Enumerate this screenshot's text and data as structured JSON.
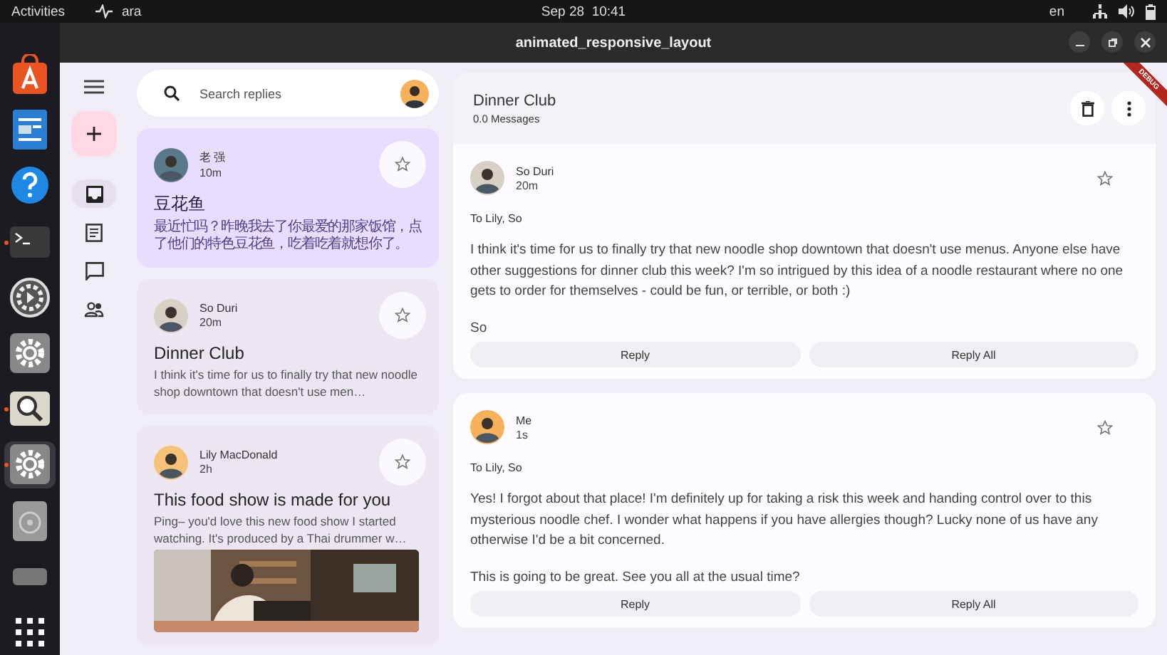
{
  "top_bar": {
    "activities": "Activities",
    "app": "ara",
    "date": "Sep 28",
    "time": "10:41",
    "language": "en"
  },
  "dock": [
    {
      "kind": "store",
      "running": false,
      "selected": false
    },
    {
      "kind": "writer",
      "running": false,
      "selected": false
    },
    {
      "kind": "help",
      "running": false,
      "selected": false
    },
    {
      "kind": "terminal",
      "running": true,
      "selected": false
    },
    {
      "kind": "media",
      "running": false,
      "selected": false
    },
    {
      "kind": "gear",
      "running": false,
      "selected": false
    },
    {
      "kind": "viewer",
      "running": true,
      "selected": false
    },
    {
      "kind": "gear",
      "running": true,
      "selected": true
    },
    {
      "kind": "disc",
      "running": false,
      "selected": false
    },
    {
      "kind": "drive",
      "running": false,
      "selected": false
    },
    {
      "kind": "apps",
      "running": false,
      "selected": false
    }
  ],
  "window": {
    "title": "animated_responsive_layout"
  },
  "debug_banner": "DEBUG",
  "nav": [
    {
      "kind": "inbox",
      "selected": true
    },
    {
      "kind": "articles",
      "selected": false
    },
    {
      "kind": "chat",
      "selected": false
    },
    {
      "kind": "groups",
      "selected": false
    }
  ],
  "search": {
    "placeholder": "Search replies"
  },
  "emails": [
    {
      "sender": "老 强",
      "time": "10m",
      "subject": "豆花鱼",
      "preview": "最近忙吗？昨晚我去了你最爱的那家饭馆，点了他们的特色豆花鱼，吃着吃着就想你了。",
      "selected": true,
      "starred": false
    },
    {
      "sender": "So Duri",
      "time": "20m",
      "subject": "Dinner Club",
      "preview": "I think it's time for us to finally try that new noodle shop downtown that doesn't use men…",
      "selected": false,
      "starred": false
    },
    {
      "sender": "Lily MacDonald",
      "time": "2h",
      "subject": "This food show is made for you",
      "preview": "Ping– you'd love this new food show I started watching. It's produced by a Thai drummer w…",
      "selected": false,
      "starred": false
    }
  ],
  "detail": {
    "title": "Dinner Club",
    "count": "0.0 Messages",
    "messages": [
      {
        "sender": "So Duri",
        "time": "20m",
        "to": "To Lily, So",
        "starred": false,
        "paragraphs": [
          "I think it's time for us to finally try that new noodle shop downtown that doesn't use menus. Anyone else have other suggestions for dinner club this week? I'm so intrigued by this idea of a noodle restaurant where no one gets to order for themselves - could be fun, or terrible, or both :)",
          "So"
        ],
        "actions": [
          "Reply",
          "Reply All"
        ]
      },
      {
        "sender": "Me",
        "time": "1s",
        "to": "To Lily, So",
        "starred": false,
        "paragraphs": [
          "Yes! I forgot about that place! I'm definitely up for taking a risk this week and handing control over to this mysterious noodle chef. I wonder what happens if you have allergies though? Lucky none of us have any otherwise I'd be a bit concerned.",
          "This is going to be great. See you all at the usual time?"
        ],
        "actions": [
          "Reply",
          "Reply All"
        ]
      }
    ]
  }
}
